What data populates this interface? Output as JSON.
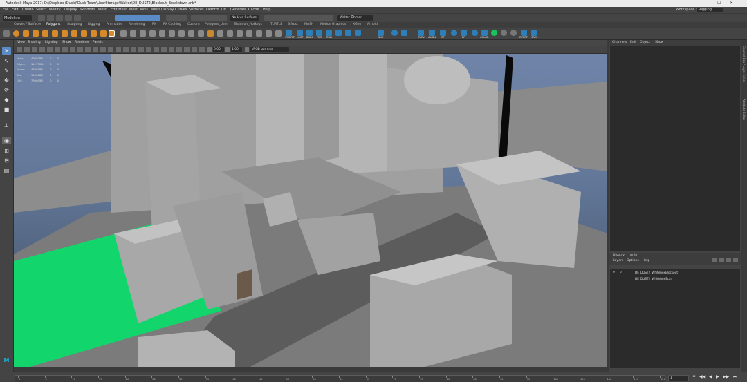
{
  "window": {
    "title": "Autodesk Maya 2017: D:\\Dropbox (Dusk)\\Dusk Team\\UserStorage\\Walter\\DE_DUST2\\Blockout_Breakdown.mb*",
    "controls": [
      "—",
      "☐",
      "✕"
    ]
  },
  "menubar": {
    "items": [
      "File",
      "Edit",
      "Create",
      "Select",
      "Modify",
      "Display",
      "Windows",
      "Mesh",
      "Edit Mesh",
      "Mesh Tools",
      "Mesh Display",
      "Curves",
      "Surfaces",
      "Deform",
      "UV",
      "Generate",
      "Cache",
      "Help"
    ],
    "workspace_label": "Workspace :",
    "workspace_value": "Rigging"
  },
  "statusline": {
    "mode": "Modeling",
    "live_surface": "No Live Surface",
    "user": "Walter Öhman"
  },
  "shelf": {
    "tabs": [
      "Curves / Surfaces",
      "Polygons",
      "Sculpting",
      "Rigging",
      "Animation",
      "Rendering",
      "FX",
      "FX Caching",
      "Custom",
      "Polygons_User",
      "Shannon_Hotkeys",
      "TURTLE",
      "Bifrost",
      "MASH",
      "Motion Graphics",
      "XGen",
      "Arnold"
    ],
    "active_tab": "Polygons",
    "button_labels": [
      "VISSPLT",
      "LOOP",
      "BURN",
      "PIPE",
      "RUN",
      "SUR",
      "CURV",
      "ALIGN",
      "CF",
      "PF",
      "COLOR",
      "RETOPI",
      "MRCV"
    ]
  },
  "viewport": {
    "menu": [
      "View",
      "Shading",
      "Lighting",
      "Show",
      "Renderer",
      "Panels"
    ],
    "exposure": "0.00",
    "gamma": "1.00",
    "color_space": "sRGB gamma",
    "hud": [
      [
        "Verts:",
        "4608088",
        "0",
        "0"
      ],
      [
        "Edges:",
        "11175044",
        "0",
        "0"
      ],
      [
        "Faces:",
        "4608088",
        "0",
        "0"
      ],
      [
        "Tris:",
        "9498088",
        "0",
        "0"
      ],
      [
        "UVs:",
        "7306093",
        "0",
        "0"
      ]
    ],
    "colors": {
      "sky_top": "#6f84a8",
      "ground": "#3c4a5d",
      "mesh_gray": "#a6a6a6",
      "green_plane": "#12d66b"
    }
  },
  "channel_box": {
    "menu": [
      "Channels",
      "Edit",
      "Object",
      "Show"
    ]
  },
  "layer_editor": {
    "tabs": [
      "Display",
      "Anim"
    ],
    "menu": [
      "Layers",
      "Options",
      "Help"
    ],
    "layers": [
      {
        "v": "V",
        "p": "P",
        "name": "DE_DUST2_WhiteboxBlockout"
      },
      {
        "v": "",
        "p": "",
        "name": "DE_DUST2_WhiteboxScan"
      }
    ]
  },
  "side_tabs": [
    "Channel Box / Layer Editor",
    "Attribute Editor"
  ],
  "timeline": {
    "ticks": [
      "1",
      "5",
      "10",
      "15",
      "20",
      "25",
      "30",
      "35",
      "40",
      "45",
      "50",
      "55",
      "60",
      "65",
      "70",
      "75",
      "80",
      "85",
      "90",
      "95",
      "100",
      "105",
      "110",
      "115",
      "120"
    ],
    "current_frame": "1",
    "playback": [
      "⏮",
      "◀◀",
      "◀",
      "▶",
      "▶▶",
      "⏭"
    ]
  }
}
